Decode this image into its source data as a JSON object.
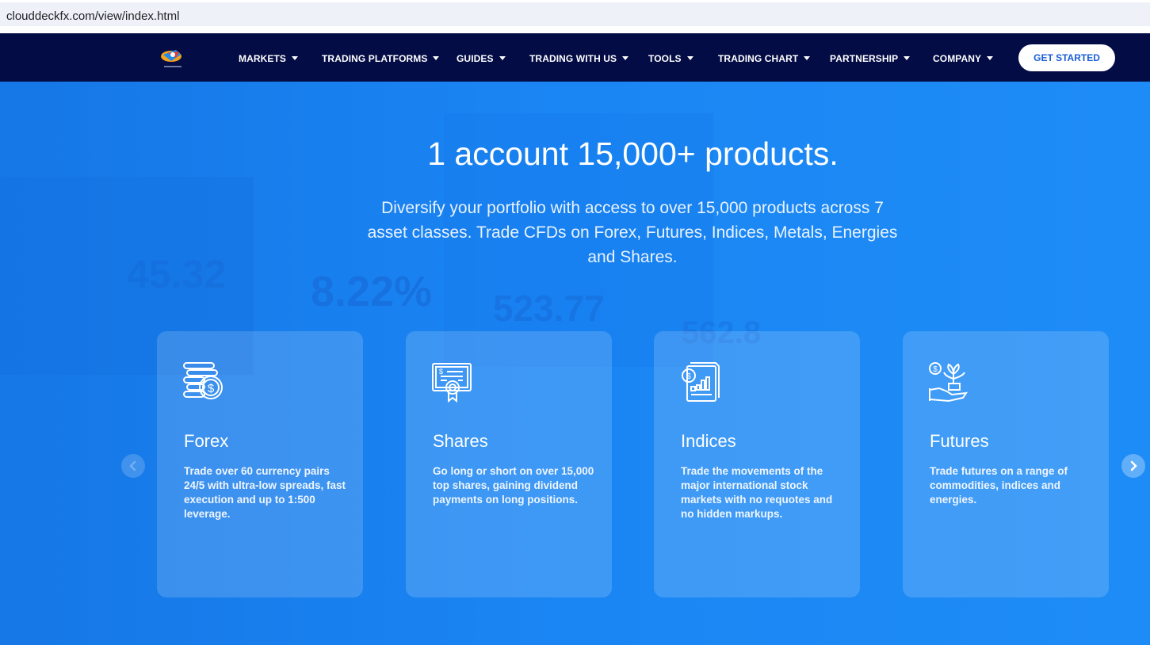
{
  "browser": {
    "url": "clouddeckfx.com/view/index.html"
  },
  "nav": {
    "items": [
      {
        "label": "MARKETS"
      },
      {
        "label": "TRADING PLATFORMS"
      },
      {
        "label": "GUIDES"
      },
      {
        "label": "TRADING WITH US"
      },
      {
        "label": "TOOLS"
      },
      {
        "label": "TRADING CHART"
      },
      {
        "label": "PARTNERSHIP"
      },
      {
        "label": "COMPANY"
      }
    ],
    "cta": "GET STARTED"
  },
  "hero": {
    "title": "1 account 15,000+ products.",
    "subtitle": "Diversify your portfolio with access to over 15,000 products across 7 asset classes. Trade CFDs on Forex, Futures, Indices, Metals, Energies and Shares.",
    "background_numbers": [
      "8.22%",
      "523.77",
      "562.8",
      "45.32"
    ]
  },
  "cards": [
    {
      "title": "Forex",
      "text": "Trade over 60 currency pairs 24/5 with ultra-low spreads, fast execution and up to 1:500 leverage.",
      "icon": "coins-dollar-icon"
    },
    {
      "title": "Shares",
      "text": "Go long or short on over 15,000 top shares, gaining dividend payments on long positions.",
      "icon": "certificate-icon"
    },
    {
      "title": "Indices",
      "text": "Trade the movements of the major international stock markets with no requotes and no hidden markups.",
      "icon": "report-chart-icon"
    },
    {
      "title": "Futures",
      "text": "Trade futures on a range of commodities, indices and energies.",
      "icon": "hand-plant-icon"
    }
  ],
  "colors": {
    "nav_bg": "#040c45",
    "hero_bg": "#1a86f4",
    "cta_text": "#1b5fd6"
  }
}
